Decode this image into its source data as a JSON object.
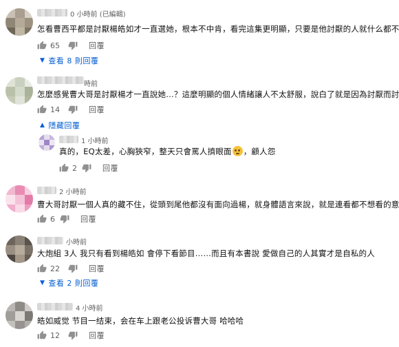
{
  "colors": {
    "link": "#065fd4",
    "meta": "#606060",
    "text": "#111111"
  },
  "comments": [
    {
      "timestamp": "0 小時前 (已編輯)",
      "text": "怎看曹西平都是討厭楊皓如才一直選她，根本不中肯，看完這集更明顯，只要是他討厭的人就什么都不是。",
      "likes": "65",
      "reply_label": "回覆",
      "view_replies": "查看 8 則回覆"
    },
    {
      "timestamp": "時前",
      "text": "怎麼感覺曹大哥是討厭楊才一直說她…？這麼明顯的個人情緒讓人不太舒服，說白了就是因為討厭而討厭",
      "likes": "14",
      "reply_label": "回覆",
      "hide_replies": "隱藏回覆",
      "reply": {
        "timestamp": "1 小時前",
        "text_before": "真的，EQ太差，心胸狹窄，整天只會罵人擠眼面",
        "text_after": "，顧人怨",
        "likes": "2",
        "reply_label": "回覆"
      }
    },
    {
      "timestamp": "2 小時前",
      "text": "曹大哥討厭一個人真的藏不住，從頭到尾他都沒有面向過楊，就身體語言來說，就是連看都不想看的意思",
      "likes": "6",
      "reply_label": "回覆"
    },
    {
      "timestamp": "小時前",
      "text": "大炮組 3人 我只有看到楊皓如 會停下看節目……而且有本書說 愛做自己的人其實才是自私的人",
      "likes": "22",
      "reply_label": "回覆",
      "view_replies": "查看 2 則回覆"
    },
    {
      "timestamp": "4 小時前",
      "text": "皓如威觉 节目一结束，会在车上跟老公投诉曹大哥 哈哈哈",
      "likes": "12",
      "reply_label": "回覆"
    }
  ]
}
